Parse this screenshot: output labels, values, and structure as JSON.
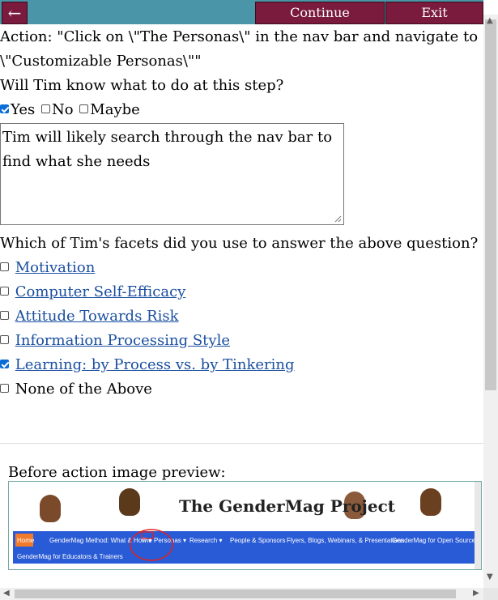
{
  "toolbar": {
    "back_label": "←",
    "continue_label": "Continue",
    "exit_label": "Exit"
  },
  "action": {
    "line1": "Action: \"Click on \\\"The Personas\\\" in the nav bar and navigate to",
    "line2": "\\\"Customizable Personas\\\"\""
  },
  "question": "Will Tim know what to do at this step?",
  "answers": [
    {
      "label": "Yes",
      "checked": true
    },
    {
      "label": "No",
      "checked": false
    },
    {
      "label": "Maybe",
      "checked": false
    }
  ],
  "response_text": "Tim will likely search through the nav bar to find what she needs",
  "facets_question": "Which of Tim's facets did you use to answer the above question?",
  "facets": [
    {
      "label": "Motivation",
      "checked": false,
      "link": true
    },
    {
      "label": "Computer Self-Efficacy",
      "checked": false,
      "link": true
    },
    {
      "label": "Attitude Towards Risk",
      "checked": false,
      "link": true
    },
    {
      "label": "Information Processing Style",
      "checked": false,
      "link": true
    },
    {
      "label": "Learning: by Process vs. by Tinkering",
      "checked": true,
      "link": true
    },
    {
      "label": "None of the Above",
      "checked": false,
      "link": false
    }
  ],
  "preview": {
    "label": "Before action image preview:",
    "site_title": "The GenderMag Project",
    "nav_items": [
      "Home",
      "GenderMag Method: What & How ▾",
      "The Personas ▾",
      "Research ▾",
      "People & Sponsors",
      "Flyers, Blogs, Webinars, & Presentations",
      "GenderMag for Open Source",
      "GenderMag for Educators & Trainers"
    ]
  },
  "colors": {
    "toolbar_bg": "#4a96a8",
    "button_bg": "#7a1a3c",
    "link": "#1a4fa0",
    "checkbox_checked": "#0a6cd6",
    "preview_nav": "#2a5bd6",
    "preview_home": "#f07a2a"
  }
}
